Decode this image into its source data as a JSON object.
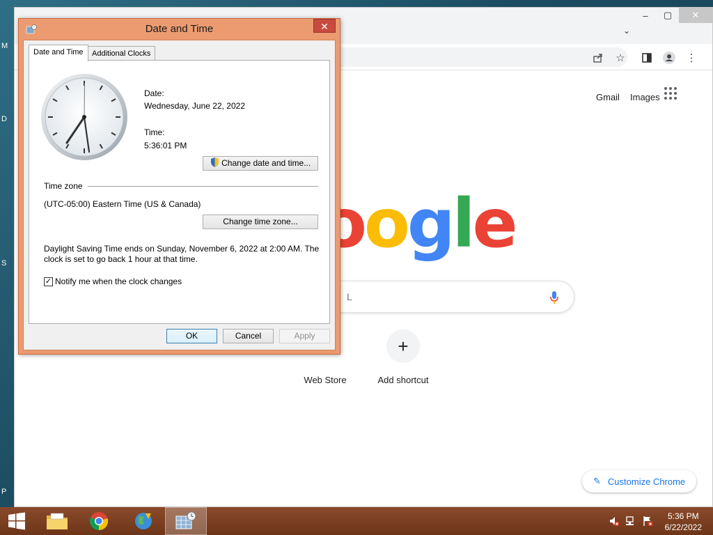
{
  "desktop": {
    "edge_letters": [
      "M",
      "D",
      "S",
      "P"
    ]
  },
  "browser": {
    "omnibox_icons": [
      "share-icon",
      "star-icon",
      "side-panel-icon",
      "profile-icon",
      "menu-icon"
    ],
    "links": {
      "gmail": "Gmail",
      "images": "Images"
    },
    "logo_letters": [
      {
        "char": "o",
        "color": "#ea4335"
      },
      {
        "char": "o",
        "color": "#fbbc05"
      },
      {
        "char": "g",
        "color": "#4285f4"
      },
      {
        "char": "l",
        "color": "#34a853"
      },
      {
        "char": "e",
        "color": "#ea4335"
      }
    ],
    "search_visible_text": "L",
    "shortcuts": [
      {
        "label": "Web Store"
      },
      {
        "label": "Add shortcut",
        "glyph": "+"
      }
    ],
    "customize_label": "Customize Chrome",
    "accent": "#1a73e8"
  },
  "dialog": {
    "title": "Date and Time",
    "close_glyph": "✕",
    "tabs": [
      "Date and Time",
      "Additional Clocks"
    ],
    "date_label": "Date:",
    "date_value": "Wednesday, June 22, 2022",
    "time_label": "Time:",
    "time_value": "5:36:01 PM",
    "change_datetime_button": "Change date and time...",
    "timezone_header": "Time zone",
    "timezone_value": "(UTC-05:00) Eastern Time (US & Canada)",
    "change_timezone_button": "Change time zone...",
    "dst_line1": "Daylight Saving Time ends on Sunday, November 6, 2022 at 2:00 AM. The",
    "dst_line2": "clock is set to go back 1 hour at that time.",
    "notify_label": "Notify me when the clock changes",
    "notify_checked": true,
    "ok_button": "OK",
    "cancel_button": "Cancel",
    "apply_button": "Apply",
    "frame_color": "#ec9b71"
  },
  "taskbar": {
    "apps": [
      "windows-start-icon",
      "file-explorer-icon",
      "chrome-icon",
      "network-globe-icon",
      "date-time-icon"
    ],
    "tray_icons": [
      "volume-muted-icon",
      "network-icon",
      "action-center-flag-icon"
    ],
    "time": "5:36 PM",
    "date": "6/22/2022",
    "color": "#7a3f21"
  }
}
